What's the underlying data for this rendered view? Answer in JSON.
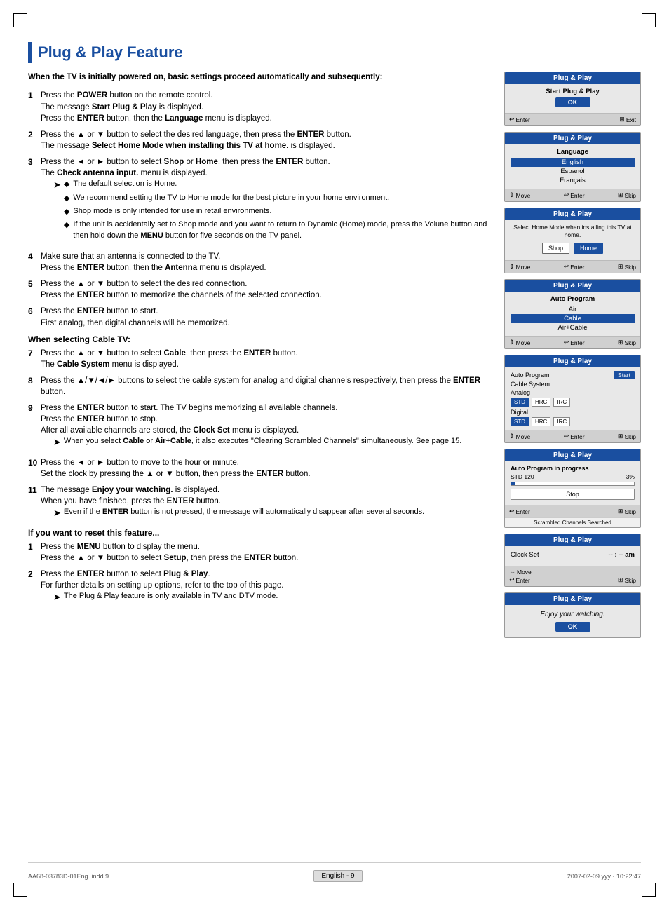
{
  "page": {
    "title": "Plug & Play Feature",
    "footer": {
      "left": "AA68-03783D-01Eng..indd   9",
      "center": "English - 9",
      "right": "2007-02-09   yyy · 10:22:47"
    }
  },
  "intro": "When the TV is initially powered on, basic settings proceed automatically and subsequently:",
  "steps": [
    {
      "num": "1",
      "text": "Press the POWER button on the remote control.\nThe message Start Plug & Play is displayed.\nPress the ENTER button, then the Language menu is displayed."
    },
    {
      "num": "2",
      "text": "Press the ▲ or ▼ button to select the desired language, then press the ENTER button.\nThe message Select Home Mode when installing this TV at home. is displayed."
    },
    {
      "num": "3",
      "text": "Press the ◄ or ► button to select Shop or Home, then press the ENTER button.\nThe Check antenna input. menu is displayed.",
      "notes": [
        "The default selection is Home.",
        "We recommend setting the TV to Home mode for the best picture in your home environment.",
        "Shop mode is only intended for use in retail environments.",
        "If the unit is accidentally set to Shop mode and you want to return to Dynamic (Home) mode, press the Volune button and then hold down the MENU button for five seconds on the TV panel."
      ]
    },
    {
      "num": "4",
      "text": "Make sure that an antenna is connected to the TV.\nPress the ENTER button, then the Antenna menu is displayed."
    },
    {
      "num": "5",
      "text": "Press the ▲ or ▼ button to select the desired connection.\nPress the ENTER button to memorize the channels of the selected connection."
    },
    {
      "num": "6",
      "text": "Press the ENTER button to start.\nFirst analog, then digital channels will be memorized."
    }
  ],
  "cable_section": {
    "header": "When selecting Cable TV:",
    "steps": [
      {
        "num": "7",
        "text": "Press the ▲ or ▼ button to select Cable, then press the ENTER button.\nThe Cable System menu is displayed."
      },
      {
        "num": "8",
        "text": "Press the ▲/▼/◄/► buttons to select the cable system for analog and digital channels respectively, then press the ENTER button."
      },
      {
        "num": "9",
        "text": "Press the ENTER button to start. The TV begins memorizing all available channels.\nPress the ENTER button to stop.\nAfter all available channels are stored, the Clock Set menu is displayed.",
        "subnotes": [
          "When you select Cable or Air+Cable, it also executes \"Clearing Scrambled Channels\" simultaneously. See page 15."
        ]
      },
      {
        "num": "10",
        "text": "Press the ◄ or ► button to move to the hour or minute.\nSet the clock by pressing the ▲ or ▼ button, then press the ENTER button."
      },
      {
        "num": "11",
        "text": "The message Enjoy your watching. is displayed.\nWhen you have finished, press the ENTER button.",
        "subnotes": [
          "Even if the ENTER button is not pressed, the message will automatically disappear after several seconds."
        ]
      }
    ]
  },
  "reset_section": {
    "header": "If you want to reset this feature...",
    "steps": [
      {
        "num": "1",
        "text": "Press the MENU button to display the menu.\nPress the ▲ or ▼ button to select Setup, then press the ENTER button."
      },
      {
        "num": "2",
        "text": "Press the ENTER button to select Plug & Play.\nFor further details on setting up options, refer to the top of this page.",
        "subnotes": [
          "The Plug & Play feature is only available in TV and DTV mode."
        ]
      }
    ]
  },
  "panels": {
    "panel1": {
      "title": "Plug & Play",
      "subtitle": "Start Plug & Play",
      "ok_label": "OK",
      "footer_enter": "Enter",
      "footer_exit": "Exit"
    },
    "panel2": {
      "title": "Plug & Play",
      "subtitle": "Language",
      "options": [
        "English",
        "Espanol",
        "Français"
      ],
      "selected": 0,
      "footer_move": "Move",
      "footer_enter": "Enter",
      "footer_skip": "Skip"
    },
    "panel3": {
      "title": "Plug & Play",
      "subtitle": "Select Home Mode when installing this TV at home.",
      "shop_label": "Shop",
      "home_label": "Home",
      "footer_move": "Move",
      "footer_enter": "Enter",
      "footer_skip": "Skip"
    },
    "panel4": {
      "title": "Plug & Play",
      "subtitle": "Auto Program",
      "options": [
        "Air",
        "Cable",
        "Air+Cable"
      ],
      "selected": 1,
      "footer_move": "Move",
      "footer_enter": "Enter",
      "footer_skip": "Skip"
    },
    "panel5": {
      "title": "Plug & Play",
      "auto_program": "Auto Program",
      "cable_system": "Cable System",
      "analog": "Analog",
      "digital": "Digital",
      "start_label": "Start",
      "std": "STD",
      "hrc": "HRC",
      "irc": "IRC",
      "footer_move": "Move",
      "footer_enter": "Enter",
      "footer_skip": "Skip"
    },
    "panel6": {
      "title": "Plug & Play",
      "subtitle": "Auto Program in progress",
      "channel": "STD 120",
      "percent": "3%",
      "stop_label": "Stop",
      "footer_enter": "Enter",
      "footer_skip": "Skip",
      "scramble_note": "Scrambled Channels Searched"
    },
    "panel7": {
      "title": "Plug & Play",
      "clock_label": "Clock Set",
      "clock_value": "-- : -- am",
      "footer_move": "Move",
      "footer_enter": "Enter",
      "footer_skip": "Skip"
    },
    "panel8": {
      "title": "Plug & Play",
      "enjoy_text": "Enjoy your watching.",
      "ok_label": "OK"
    }
  }
}
